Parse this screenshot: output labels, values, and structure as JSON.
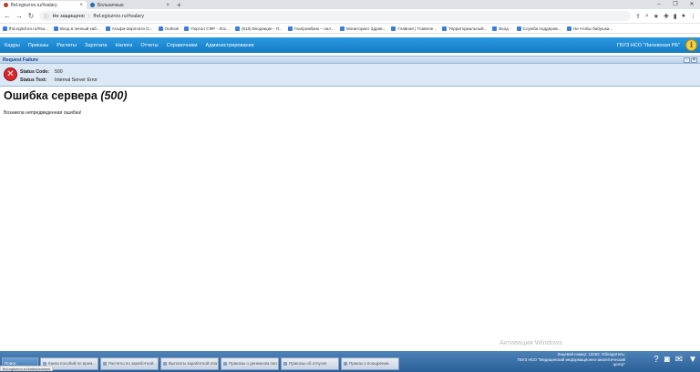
{
  "browser": {
    "tabs": [
      {
        "title": "fhd.egiszroo.ru/#salary",
        "active": true
      },
      {
        "title": "Больничные",
        "active": false
      }
    ],
    "new_tab": "+",
    "window_controls": [
      "–",
      "❐",
      "✕"
    ],
    "address": {
      "security": "Не защищено",
      "separator": "|",
      "url": "fhd.egiszroo.ru/#salary"
    },
    "bookmarks": [
      "fhd.egiszroo.ru/#sa...",
      "Вход в личный каб...",
      "Альфа-Зарплата О...",
      "Outlook",
      "Портал СФР - Лос...",
      "(518) Входящие - П...",
      "Газпромбанк – онл...",
      "Мониторинг Здрав...",
      "Главная | Главное...",
      "Территориальный...",
      "Вход -",
      "Служба поддержк...",
      "Не чтобы бабушка..."
    ]
  },
  "app": {
    "menu": [
      "Кадры",
      "Приказы",
      "Расчеты",
      "Зарплата",
      "Налоги",
      "Отчеты",
      "Справочники",
      "Администрирование"
    ],
    "organization": "ГБУЗ НСО \"Линевская РБ\"",
    "info_glyph": "i"
  },
  "error": {
    "panel_title": "Request Failure",
    "status_code_label": "Status Code:",
    "status_code": "500",
    "status_text_label": "Status Text:",
    "status_text": "Internal Server Error",
    "heading": "Ошибка сервера",
    "heading_code": "(500)",
    "message": "Возникла непредвиденная ошибка!"
  },
  "watermark": "Активация Windows",
  "status_url": "fhd.egiszroo.ru/salary/salary#",
  "taskbar": {
    "tasks": [
      "Поиск",
      "Книги пособий по врем...",
      "Расчеты по заработной...",
      "Выплаты заработной плат...",
      "Приказы о денежном поо...",
      "Приказы об отпуске",
      "Приказ о поощрении"
    ],
    "user_info": [
      "Лицевой номер: 12263. Обладатель:",
      "ГБУЗ НСО \"Медицинский информационно-аналитический",
      "центр\""
    ]
  }
}
